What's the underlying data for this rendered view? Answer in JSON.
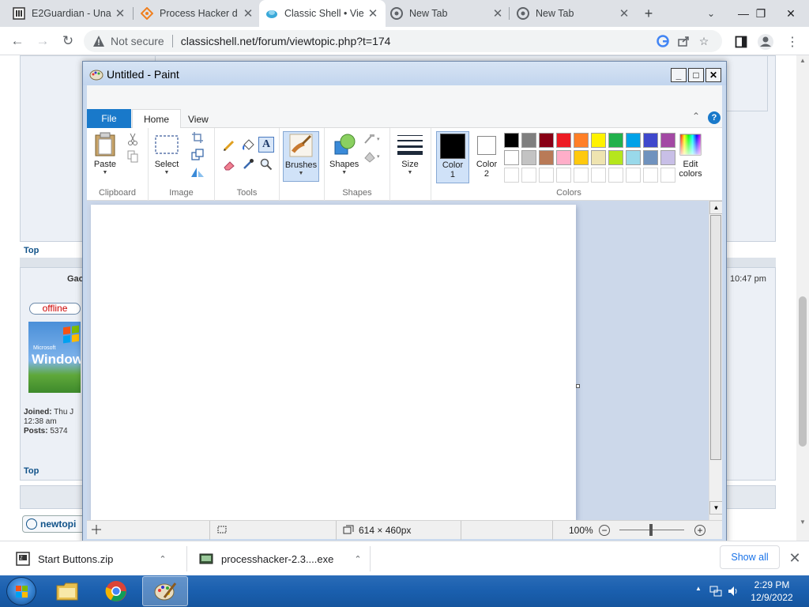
{
  "browser": {
    "tabs": [
      {
        "label": "E2Guardian - Una",
        "active": false
      },
      {
        "label": "Process Hacker d",
        "active": false
      },
      {
        "label": "Classic Shell • Vie",
        "active": true
      },
      {
        "label": "New Tab",
        "active": false
      },
      {
        "label": "New Tab",
        "active": false
      }
    ],
    "new_tab_glyph": "+",
    "security_label": "Not secure",
    "url": "classicshell.net/forum/viewtopic.php?t=174"
  },
  "webpage": {
    "top_link_1": "Top",
    "top_link_2": "Top",
    "author_partial": "Gac",
    "post_time": "10:47 pm",
    "status_badge": "offline",
    "avatar_small_text": "Microsoft",
    "avatar_big_text": "Window",
    "joined_label": "Joined:",
    "joined_value": "Thu J",
    "joined_value_2": "12:38 am",
    "posts_label": "Posts:",
    "posts_value": "5374",
    "newtopic_label": "newtopi"
  },
  "paint": {
    "title": "Untitled - Paint",
    "tabs": {
      "file": "File",
      "home": "Home",
      "view": "View"
    },
    "help_glyph": "?",
    "groups": {
      "clipboard": "Clipboard",
      "image": "Image",
      "tools": "Tools",
      "shapes": "Shapes",
      "colors": "Colors"
    },
    "buttons": {
      "paste": "Paste",
      "select": "Select",
      "brushes": "Brushes",
      "shapes": "Shapes",
      "size": "Size",
      "color1_line1": "Color",
      "color1_line2": "1",
      "color2_line1": "Color",
      "color2_line2": "2",
      "edit_colors_line1": "Edit",
      "edit_colors_line2": "colors"
    },
    "palette_row1": [
      "#000000",
      "#7f7f7f",
      "#880015",
      "#ed1c24",
      "#ff7f27",
      "#fff200",
      "#22b14c",
      "#00a2e8",
      "#3f48cc",
      "#a349a4"
    ],
    "palette_row2": [
      "#ffffff",
      "#c3c3c3",
      "#b97a57",
      "#ffaec9",
      "#ffc90e",
      "#efe4b0",
      "#b5e61d",
      "#99d9ea",
      "#7092be",
      "#c8bfe7"
    ],
    "color1": "#000000",
    "color2": "#ffffff",
    "status": {
      "image_size": "614 × 460px",
      "zoom": "100%"
    }
  },
  "downloads": {
    "items": [
      {
        "label": "Start Buttons.zip"
      },
      {
        "label": "processhacker-2.3....exe"
      }
    ],
    "show_all": "Show all"
  },
  "taskbar": {
    "time": "2:29 PM",
    "date": "12/9/2022"
  }
}
